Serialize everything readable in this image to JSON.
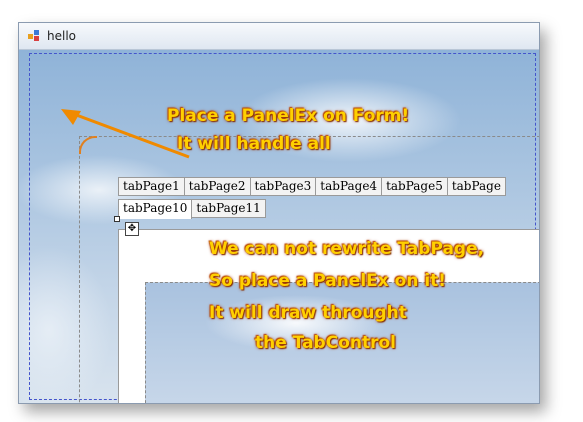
{
  "window": {
    "title": "hello"
  },
  "tabs": {
    "row1": [
      "tabPage1",
      "tabPage2",
      "tabPage3",
      "tabPage4",
      "tabPage5",
      "tabPage"
    ],
    "row2": [
      "tabPage10",
      "tabPage11"
    ],
    "selected": "tabPage10"
  },
  "annotations": {
    "form_line1": "Place a PanelEx on Form!",
    "form_line2": "It will handle all",
    "tab_line1": "We can not rewrite TabPage,",
    "tab_line2": "So place a  PanelEx on it!",
    "tab_line3": "It will draw throught",
    "tab_line4": "the TabControl"
  },
  "colors": {
    "annotation_text": "#ffd000",
    "annotation_outline": "#a63a00",
    "arrow": "#f08a00",
    "panel_border": "#4455cc"
  }
}
